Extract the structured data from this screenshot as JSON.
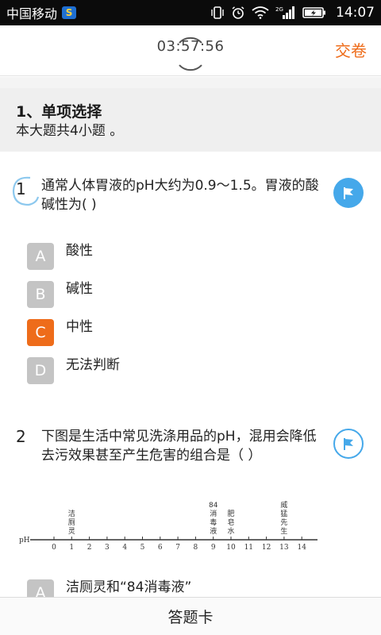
{
  "status_bar": {
    "carrier": "中国移动",
    "app_badge": "S",
    "time": "14:07",
    "network": "2G"
  },
  "header": {
    "timer": "03:57:56",
    "submit_label": "交卷"
  },
  "section": {
    "title": "1、单项选择",
    "description": "本大题共4小题 。"
  },
  "questions": [
    {
      "number": "1",
      "text": "通常人体胃液的pH大约为0.9～1.5。胃液的酸碱性为(    )",
      "options": [
        {
          "letter": "A",
          "text": "酸性",
          "selected": false
        },
        {
          "letter": "B",
          "text": "碱性",
          "selected": false
        },
        {
          "letter": "C",
          "text": "中性",
          "selected": true
        },
        {
          "letter": "D",
          "text": "无法判断",
          "selected": false
        }
      ]
    },
    {
      "number": "2",
      "text": "下图是生活中常见洗涤用品的pH，混用会降低去污效果甚至产生危害的组合是（    ）",
      "figure": {
        "axis_label": "pH",
        "ticks": [
          "0",
          "1",
          "2",
          "3",
          "4",
          "5",
          "6",
          "7",
          "8",
          "9",
          "10",
          "11",
          "12",
          "13",
          "14"
        ],
        "products": [
          {
            "name": "洁厕灵",
            "value": 1
          },
          {
            "name": "84消毒液",
            "value": 9
          },
          {
            "name": "肥皂水",
            "value": 10
          },
          {
            "name": "威猛先生",
            "value": 13
          }
        ]
      },
      "options": [
        {
          "letter": "A",
          "text": "洁厕灵和“84消毒液”",
          "selected": false
        }
      ]
    }
  ],
  "footer": {
    "answer_card_label": "答题卡"
  },
  "colors": {
    "accent": "#ee6c1a",
    "flag": "#45a8ea",
    "option_default": "#c4c4c4"
  }
}
